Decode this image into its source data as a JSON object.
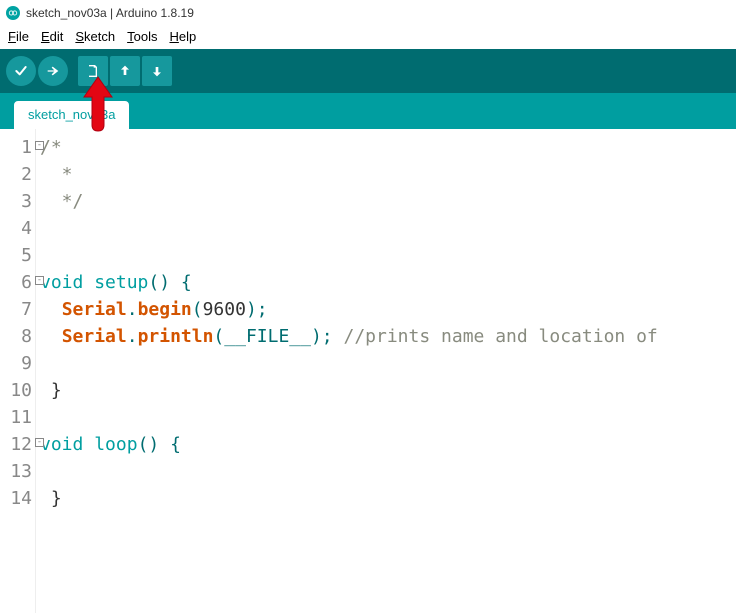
{
  "title": "sketch_nov03a | Arduino 1.8.19",
  "menu": {
    "file": {
      "u": "F",
      "rest": "ile"
    },
    "edit": {
      "u": "E",
      "rest": "dit"
    },
    "sketch": {
      "u": "S",
      "rest": "ketch"
    },
    "tools": {
      "u": "T",
      "rest": "ools"
    },
    "help": {
      "u": "H",
      "rest": "elp"
    }
  },
  "tabs": {
    "active": "sketch_nov03a"
  },
  "code": {
    "lines": [
      {
        "n": 1,
        "fold": true,
        "segments": [
          {
            "cls": "cm-cmt",
            "t": "/*"
          }
        ]
      },
      {
        "n": 2,
        "fold": false,
        "segments": [
          {
            "cls": "cm-cmt",
            "t": "  *"
          }
        ]
      },
      {
        "n": 3,
        "fold": false,
        "segments": [
          {
            "cls": "cm-cmt",
            "t": "  */"
          }
        ]
      },
      {
        "n": 4,
        "fold": false,
        "segments": []
      },
      {
        "n": 5,
        "fold": false,
        "segments": []
      },
      {
        "n": 6,
        "fold": true,
        "segments": [
          {
            "cls": "cm-key",
            "t": "void"
          },
          {
            "cls": "cm-tx",
            "t": " "
          },
          {
            "cls": "cm-key",
            "t": "setup"
          },
          {
            "cls": "cm-par",
            "t": "() {"
          }
        ]
      },
      {
        "n": 7,
        "fold": false,
        "segments": [
          {
            "cls": "cm-tx",
            "t": "  "
          },
          {
            "cls": "cm-id",
            "t": "Serial"
          },
          {
            "cls": "cm-par",
            "t": "."
          },
          {
            "cls": "cm-id",
            "t": "begin"
          },
          {
            "cls": "cm-par",
            "t": "("
          },
          {
            "cls": "cm-num",
            "t": "9600"
          },
          {
            "cls": "cm-par",
            "t": ");"
          }
        ]
      },
      {
        "n": 8,
        "fold": false,
        "segments": [
          {
            "cls": "cm-tx",
            "t": "  "
          },
          {
            "cls": "cm-id",
            "t": "Serial"
          },
          {
            "cls": "cm-par",
            "t": "."
          },
          {
            "cls": "cm-id",
            "t": "println"
          },
          {
            "cls": "cm-par",
            "t": "("
          },
          {
            "cls": "cm-mac",
            "t": "__FILE__"
          },
          {
            "cls": "cm-par",
            "t": "); "
          },
          {
            "cls": "cm-cmt",
            "t": "//prints name and location of"
          }
        ]
      },
      {
        "n": 9,
        "fold": false,
        "segments": []
      },
      {
        "n": 10,
        "fold": false,
        "segments": [
          {
            "cls": "cm-tx",
            "t": " }"
          }
        ]
      },
      {
        "n": 11,
        "fold": false,
        "segments": []
      },
      {
        "n": 12,
        "fold": true,
        "segments": [
          {
            "cls": "cm-key",
            "t": "void"
          },
          {
            "cls": "cm-tx",
            "t": " "
          },
          {
            "cls": "cm-key",
            "t": "loop"
          },
          {
            "cls": "cm-par",
            "t": "() {"
          }
        ]
      },
      {
        "n": 13,
        "fold": false,
        "segments": []
      },
      {
        "n": 14,
        "fold": false,
        "segments": [
          {
            "cls": "cm-tx",
            "t": " }"
          }
        ]
      }
    ]
  }
}
